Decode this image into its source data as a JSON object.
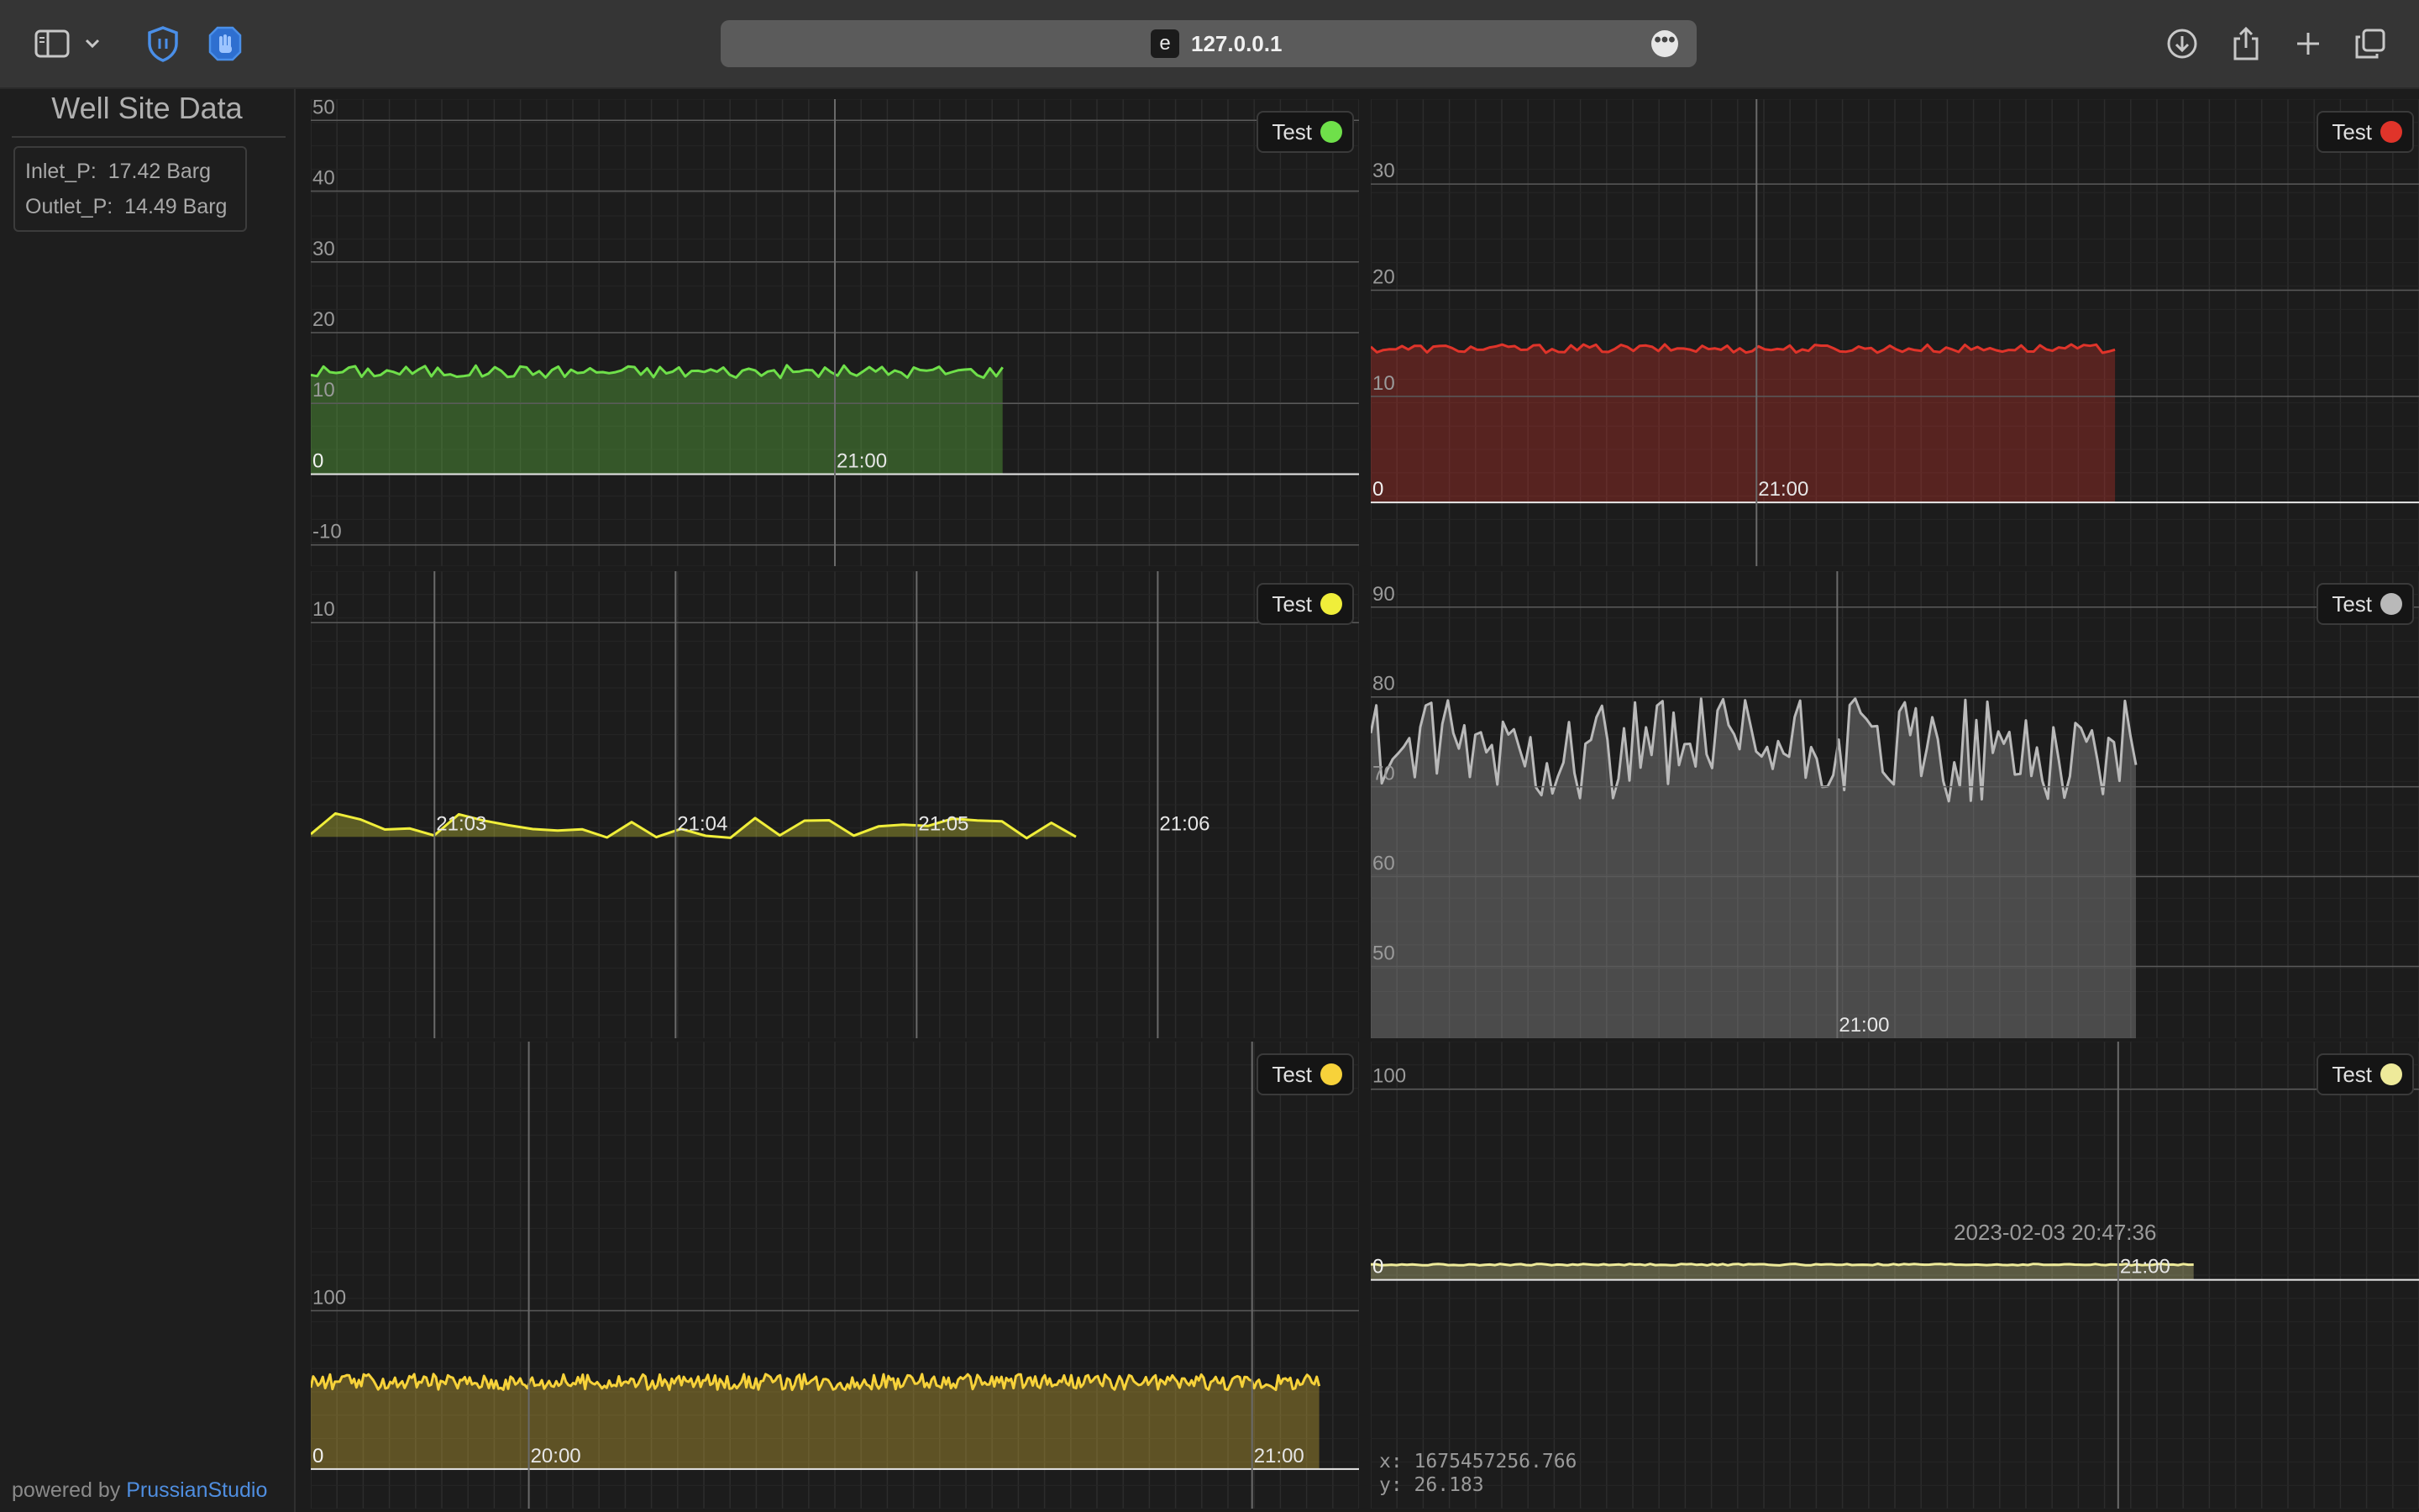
{
  "browser": {
    "url": "127.0.0.1",
    "site_badge": "e",
    "more_glyph": "•••"
  },
  "sidebar": {
    "title": "Well Site Data",
    "readings": [
      {
        "label": "Inlet_P:",
        "value": "17.42 Barg"
      },
      {
        "label": "Outlet_P:",
        "value": "14.49 Barg"
      }
    ],
    "footer_prefix": "powered by ",
    "footer_link": "PrussianStudio"
  },
  "crosshair_readout": {
    "x": "x: 1675457256.766",
    "y": "y: 26.183",
    "time": "2023-02-03 20:47:36"
  },
  "chart_data": [
    {
      "type": "area",
      "legend": "Test",
      "color": "#6fe04a",
      "yticks": [
        -10,
        0,
        10,
        20,
        30,
        40,
        50
      ],
      "ylim": [
        -13,
        53
      ],
      "xticks": [
        "21:00"
      ],
      "x_tick_positions": [
        0.5
      ],
      "data_extent": 0.66,
      "base": 14.5,
      "amp": 0.9,
      "points": 110
    },
    {
      "type": "area",
      "legend": "Test",
      "color": "#e0342a",
      "yticks": [
        0,
        10,
        20,
        30
      ],
      "ylim": [
        -6,
        38
      ],
      "xticks": [
        "21:00"
      ],
      "x_tick_positions": [
        0.368
      ],
      "data_extent": 0.71,
      "base": 14.5,
      "amp": 0.4,
      "points": 120
    },
    {
      "type": "area",
      "legend": "Test",
      "color": "#f0ee3a",
      "yticks": [
        10
      ],
      "ylim": [
        -9.4,
        12.4
      ],
      "xticks": [
        "21:03",
        "21:04",
        "21:05",
        "21:06"
      ],
      "x_tick_positions": [
        0.118,
        0.348,
        0.578,
        0.808
      ],
      "data_extent": 0.73,
      "base": 0.5,
      "amp": 0.6,
      "points": 32
    },
    {
      "type": "area",
      "legend": "Test",
      "color": "#b9b9b9",
      "yticks": [
        50,
        60,
        70,
        80,
        90
      ],
      "ylim": [
        42,
        94
      ],
      "xticks": [
        "21:00"
      ],
      "x_tick_positions": [
        0.445
      ],
      "data_extent": 0.73,
      "base": 74,
      "amp": 6,
      "points": 140
    },
    {
      "type": "area",
      "legend": "Test",
      "color": "#f7d23a",
      "yticks": [
        0,
        100
      ],
      "ylim": [
        -25,
        270
      ],
      "xticks": [
        "20:00",
        "21:00"
      ],
      "x_tick_positions": [
        0.208,
        0.898
      ],
      "data_extent": 0.962,
      "base": 55,
      "amp": 5,
      "points": 420
    },
    {
      "type": "area",
      "legend": "Test",
      "color": "#eeea9a",
      "yticks": [
        0,
        100
      ],
      "ylim": [
        -120,
        125
      ],
      "xticks": [
        "21:00"
      ],
      "x_tick_positions": [
        0.713
      ],
      "data_extent": 0.785,
      "base": 8,
      "amp": 0.4,
      "points": 160
    }
  ]
}
